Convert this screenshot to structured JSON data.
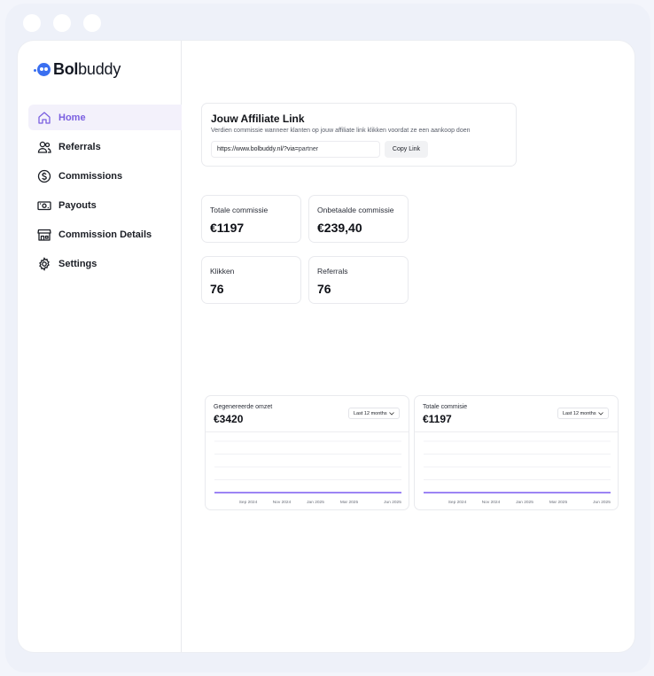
{
  "brand": {
    "bold": "Bol",
    "regular": "buddy"
  },
  "nav": [
    {
      "label": "Home",
      "icon": "home-icon",
      "active": true
    },
    {
      "label": "Referrals",
      "icon": "users-icon"
    },
    {
      "label": "Commissions",
      "icon": "dollar-icon"
    },
    {
      "label": "Payouts",
      "icon": "money-icon"
    },
    {
      "label": "Commission Details",
      "icon": "store-icon"
    },
    {
      "label": "Settings",
      "icon": "gear-icon"
    }
  ],
  "affiliate": {
    "title": "Jouw Affiliate Link",
    "subtitle": "Verdien commissie wanneer klanten op jouw affiliate link klikken voordat ze een aankoop doen",
    "link_prefix": "https://www.bolbuddy.nl/?via=",
    "link_suffix": "partner",
    "copy_label": "Copy Link"
  },
  "stats": [
    {
      "label": "Totale commissie",
      "value": "€1197"
    },
    {
      "label": "Onbetaalde commissie",
      "value": "€239,40"
    },
    {
      "label": "Klikken",
      "value": "76"
    },
    {
      "label": "Referrals",
      "value": "76"
    }
  ],
  "colors": {
    "accent": "#7a5fe0",
    "line": "#7b5cf0",
    "brand_blue": "#3a6ff0"
  },
  "charts": [
    {
      "label": "Gegenereerde omzet",
      "value": "€3420",
      "range": "Last 12 months"
    },
    {
      "label": "Totale commisie",
      "value": "€1197",
      "range": "Last 12 months"
    }
  ],
  "chart_data": [
    {
      "type": "line",
      "title": "Gegenereerde omzet",
      "x_ticks": [
        "Sep 2024",
        "Nov 2024",
        "Jan 2025",
        "Mar 2025",
        "Jun 2025"
      ],
      "series": [
        {
          "values": [
            0,
            0,
            0,
            0,
            0
          ]
        }
      ],
      "grid": true
    },
    {
      "type": "line",
      "title": "Totale commisie",
      "x_ticks": [
        "Sep 2024",
        "Nov 2024",
        "Jan 2025",
        "Mar 2025",
        "Jun 2025"
      ],
      "series": [
        {
          "values": [
            0,
            0,
            0,
            0,
            0
          ]
        }
      ],
      "grid": true
    }
  ]
}
